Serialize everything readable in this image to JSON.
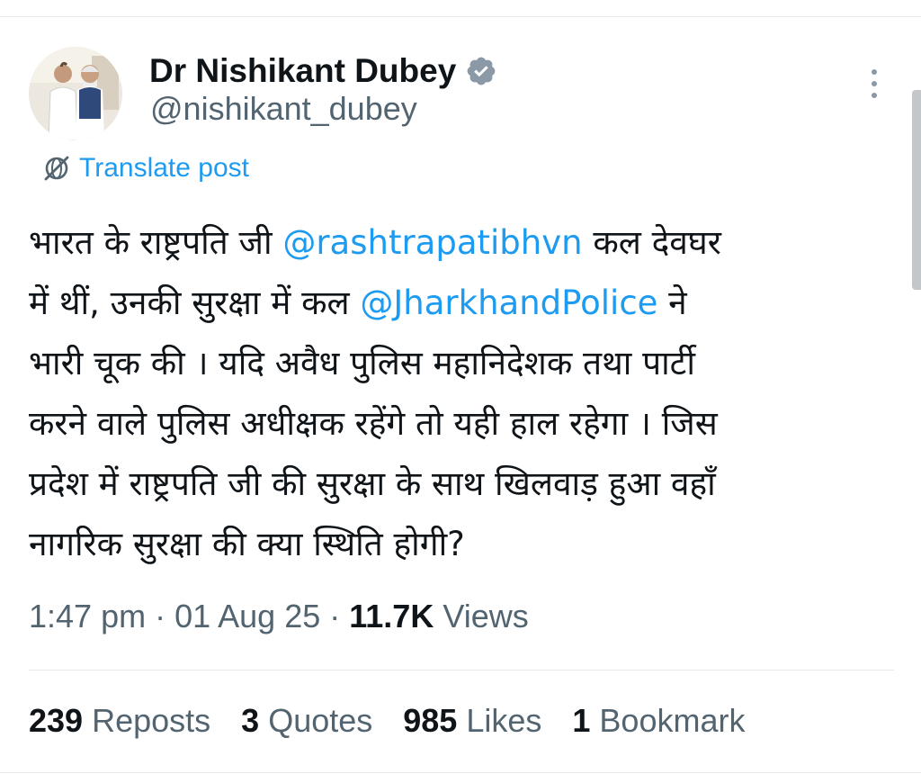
{
  "author": {
    "display_name": "Dr Nishikant Dubey",
    "handle": "@nishikant_dubey",
    "verified_icon": "verified-badge-icon",
    "verified_color": "#8b98a5"
  },
  "translate": {
    "label": "Translate post",
    "icon": "globe-slash-icon",
    "color": "#1d9bf0"
  },
  "tweet": {
    "line1": {
      "pre": "भारत के राष्ट्रपति जी ",
      "mention": "@rashtrapatibhvn",
      "post": " कल देवघर"
    },
    "line2": {
      "pre": "में थीं, उनकी सुरक्षा में कल ",
      "mention": "@JharkhandPolice",
      "post": " ने"
    },
    "line3": "भारी चूक की । यदि अवैध पुलिस महानिदेशक तथा पार्टी",
    "line4": "करने वाले पुलिस अधीक्षक रहेंगे तो यही हाल रहेगा । जिस",
    "line5": "प्रदेश में राष्ट्रपति जी की सुरक्षा के साथ खिलवाड़ हुआ वहाँ",
    "line6": "नागरिक सुरक्षा की क्या स्थिति होगी?"
  },
  "meta": {
    "time": "1:47 pm",
    "date": "01 Aug 25",
    "separator": " · ",
    "views_count": "11.7K",
    "views_label": " Views"
  },
  "stats": {
    "reposts": {
      "count": "239",
      "label": " Reposts"
    },
    "quotes": {
      "count": "3",
      "label": " Quotes"
    },
    "likes": {
      "count": "985",
      "label": " Likes"
    },
    "bookmarks": {
      "count": "1",
      "label": " Bookmark"
    }
  },
  "colors": {
    "text": "#0f1419",
    "secondary": "#536471",
    "link": "#1d9bf0",
    "divider": "#e7e9ea"
  }
}
